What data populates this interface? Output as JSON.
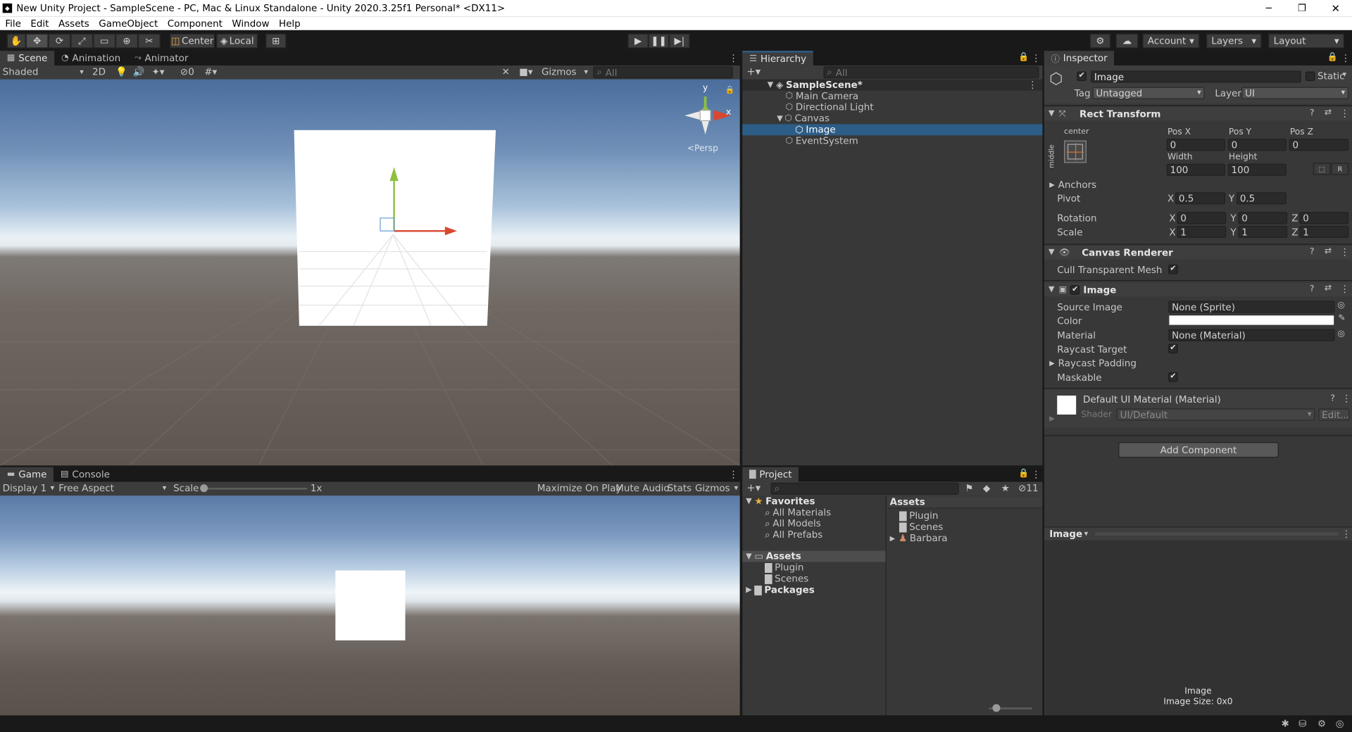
{
  "window": {
    "title": "New Unity Project - SampleScene - PC, Mac & Linux Standalone - Unity 2020.3.25f1 Personal* <DX11>",
    "controls": [
      "─",
      "❐",
      "✕"
    ]
  },
  "menu": [
    "File",
    "Edit",
    "Assets",
    "GameObject",
    "Component",
    "Window",
    "Help"
  ],
  "toolbar": {
    "pivot": "Center",
    "space": "Local",
    "account": "Account",
    "layers": "Layers",
    "layout": "Layout"
  },
  "scene": {
    "tabs": [
      "Scene",
      "Animation",
      "Animator"
    ],
    "shading": "Shaded",
    "mode2d": "2D",
    "hidden_count": "0",
    "gizmos": "Gizmos",
    "search_placeholder": "All",
    "persp": "<Persp",
    "axis_x": "x",
    "axis_y": "y"
  },
  "game": {
    "tabs": [
      "Game",
      "Console"
    ],
    "display": "Display 1",
    "aspect": "Free Aspect",
    "scale_label": "Scale",
    "scale_value": "1x",
    "scale_fraction": 0.0,
    "maximize": "Maximize On Play",
    "mute": "Mute Audio",
    "stats": "Stats",
    "gizmos": "Gizmos"
  },
  "hierarchy": {
    "tab": "Hierarchy",
    "search_placeholder": "All",
    "items": [
      "SampleScene*",
      "Main Camera",
      "Directional Light",
      "Canvas",
      "Image",
      "EventSystem"
    ]
  },
  "project": {
    "tab": "Project",
    "hidden_count": "11",
    "favorites": "Favorites",
    "fav_items": [
      "All Materials",
      "All Models",
      "All Prefabs"
    ],
    "assets": "Assets",
    "asset_folders": [
      "Plugin",
      "Scenes"
    ],
    "packages": "Packages",
    "right_header": "Assets",
    "right_items": [
      "Plugin",
      "Scenes",
      "Barbara"
    ]
  },
  "inspector": {
    "tab": "Inspector",
    "object_name": "Image",
    "static": "Static",
    "tag_label": "Tag",
    "tag_value": "Untagged",
    "layer_label": "Layer",
    "layer_value": "UI",
    "rect": {
      "title": "Rect Transform",
      "anchor_h": "center",
      "anchor_v": "middle",
      "posx_label": "Pos X",
      "posy_label": "Pos Y",
      "posz_label": "Pos Z",
      "posx": "0",
      "posy": "0",
      "posz": "0",
      "width_label": "Width",
      "height_label": "Height",
      "width": "100",
      "height": "100",
      "raw": "R",
      "anchors": "Anchors",
      "pivot": "Pivot",
      "pivot_x": "0.5",
      "pivot_y": "0.5",
      "rotation": "Rotation",
      "rot_x": "0",
      "rot_y": "0",
      "rot_z": "0",
      "scale": "Scale",
      "scale_x": "1",
      "scale_y": "1",
      "scale_z": "1",
      "x": "X",
      "y": "Y",
      "z": "Z"
    },
    "canvas_renderer": {
      "title": "Canvas Renderer",
      "cull": "Cull Transparent Mesh"
    },
    "image": {
      "title": "Image",
      "source_label": "Source Image",
      "source_value": "None (Sprite)",
      "color_label": "Color",
      "material_label": "Material",
      "material_value": "None (Material)",
      "raycast_target": "Raycast Target",
      "raycast_padding": "Raycast Padding",
      "maskable": "Maskable"
    },
    "material": {
      "title": "Default UI Material (Material)",
      "shader_label": "Shader",
      "shader_value": "UI/Default",
      "edit": "Edit..."
    },
    "add_component": "Add Component",
    "preview": {
      "dropdown": "Image",
      "name": "Image",
      "size": "Image Size: 0x0"
    }
  },
  "colors": {
    "accent": "#2c5d87",
    "panel": "#383838",
    "white": "#ffffff"
  }
}
